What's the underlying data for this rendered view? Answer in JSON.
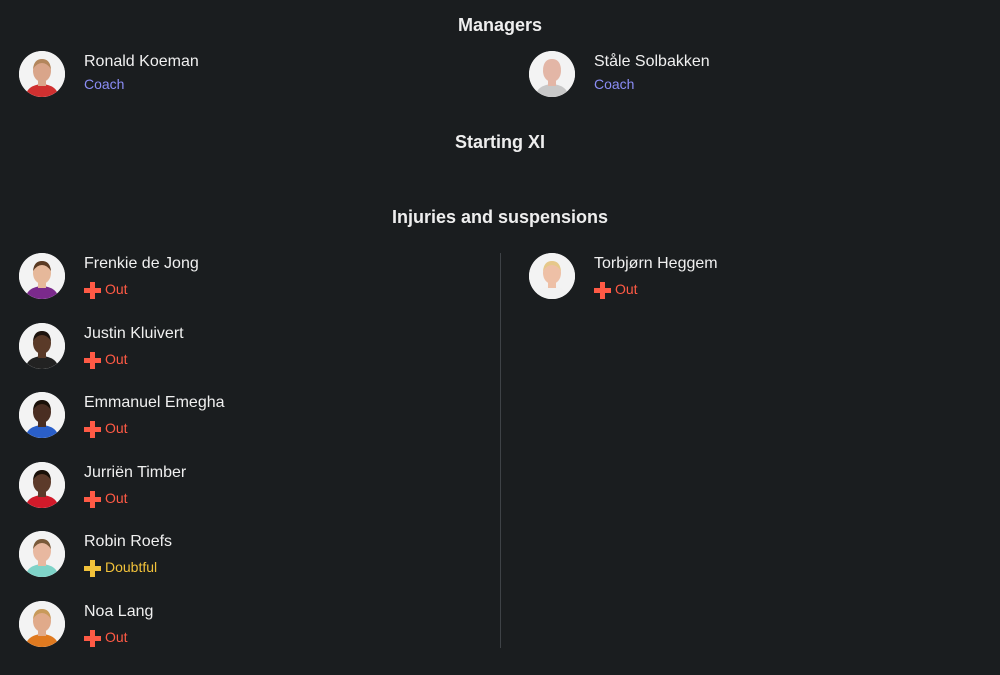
{
  "managers": {
    "title": "Managers",
    "items": [
      {
        "name": "Ronald Koeman",
        "role": "Coach",
        "skin": "#d9a58a",
        "shirt": "#d03030",
        "hair": "#b3865c"
      },
      {
        "name": "Ståle Solbakken",
        "role": "Coach",
        "skin": "#e3b6a6",
        "shirt": "#c8c8c8",
        "hair": "#e3b6a6"
      }
    ]
  },
  "starting_xi": {
    "title": "Starting XI"
  },
  "injuries": {
    "title": "Injuries and suspensions",
    "left": [
      {
        "name": "Frenkie de Jong",
        "status": "Out",
        "kind": "out",
        "skin": "#e6b89a",
        "shirt": "#7b2a8c",
        "hair": "#5a3a22"
      },
      {
        "name": "Justin Kluivert",
        "status": "Out",
        "kind": "out",
        "skin": "#5a3a28",
        "shirt": "#222222",
        "hair": "#1e140e"
      },
      {
        "name": "Emmanuel Emegha",
        "status": "Out",
        "kind": "out",
        "skin": "#4a2e22",
        "shirt": "#2a5fc9",
        "hair": "#1a1008"
      },
      {
        "name": "Jurriën Timber",
        "status": "Out",
        "kind": "out",
        "skin": "#5c3a2a",
        "shirt": "#d11a2a",
        "hair": "#1a1008"
      },
      {
        "name": "Robin Roefs",
        "status": "Doubtful",
        "kind": "doubt",
        "skin": "#e8b8a0",
        "shirt": "#7fd3c8",
        "hair": "#7a5a3a"
      },
      {
        "name": "Noa Lang",
        "status": "Out",
        "kind": "out",
        "skin": "#e0aa8a",
        "shirt": "#e07a20",
        "hair": "#c89a5a"
      }
    ],
    "right": [
      {
        "name": "Torbjørn Heggem",
        "status": "Out",
        "kind": "out",
        "skin": "#eec0a6",
        "shirt": "#f2f2f2",
        "hair": "#e6c88a"
      }
    ]
  }
}
